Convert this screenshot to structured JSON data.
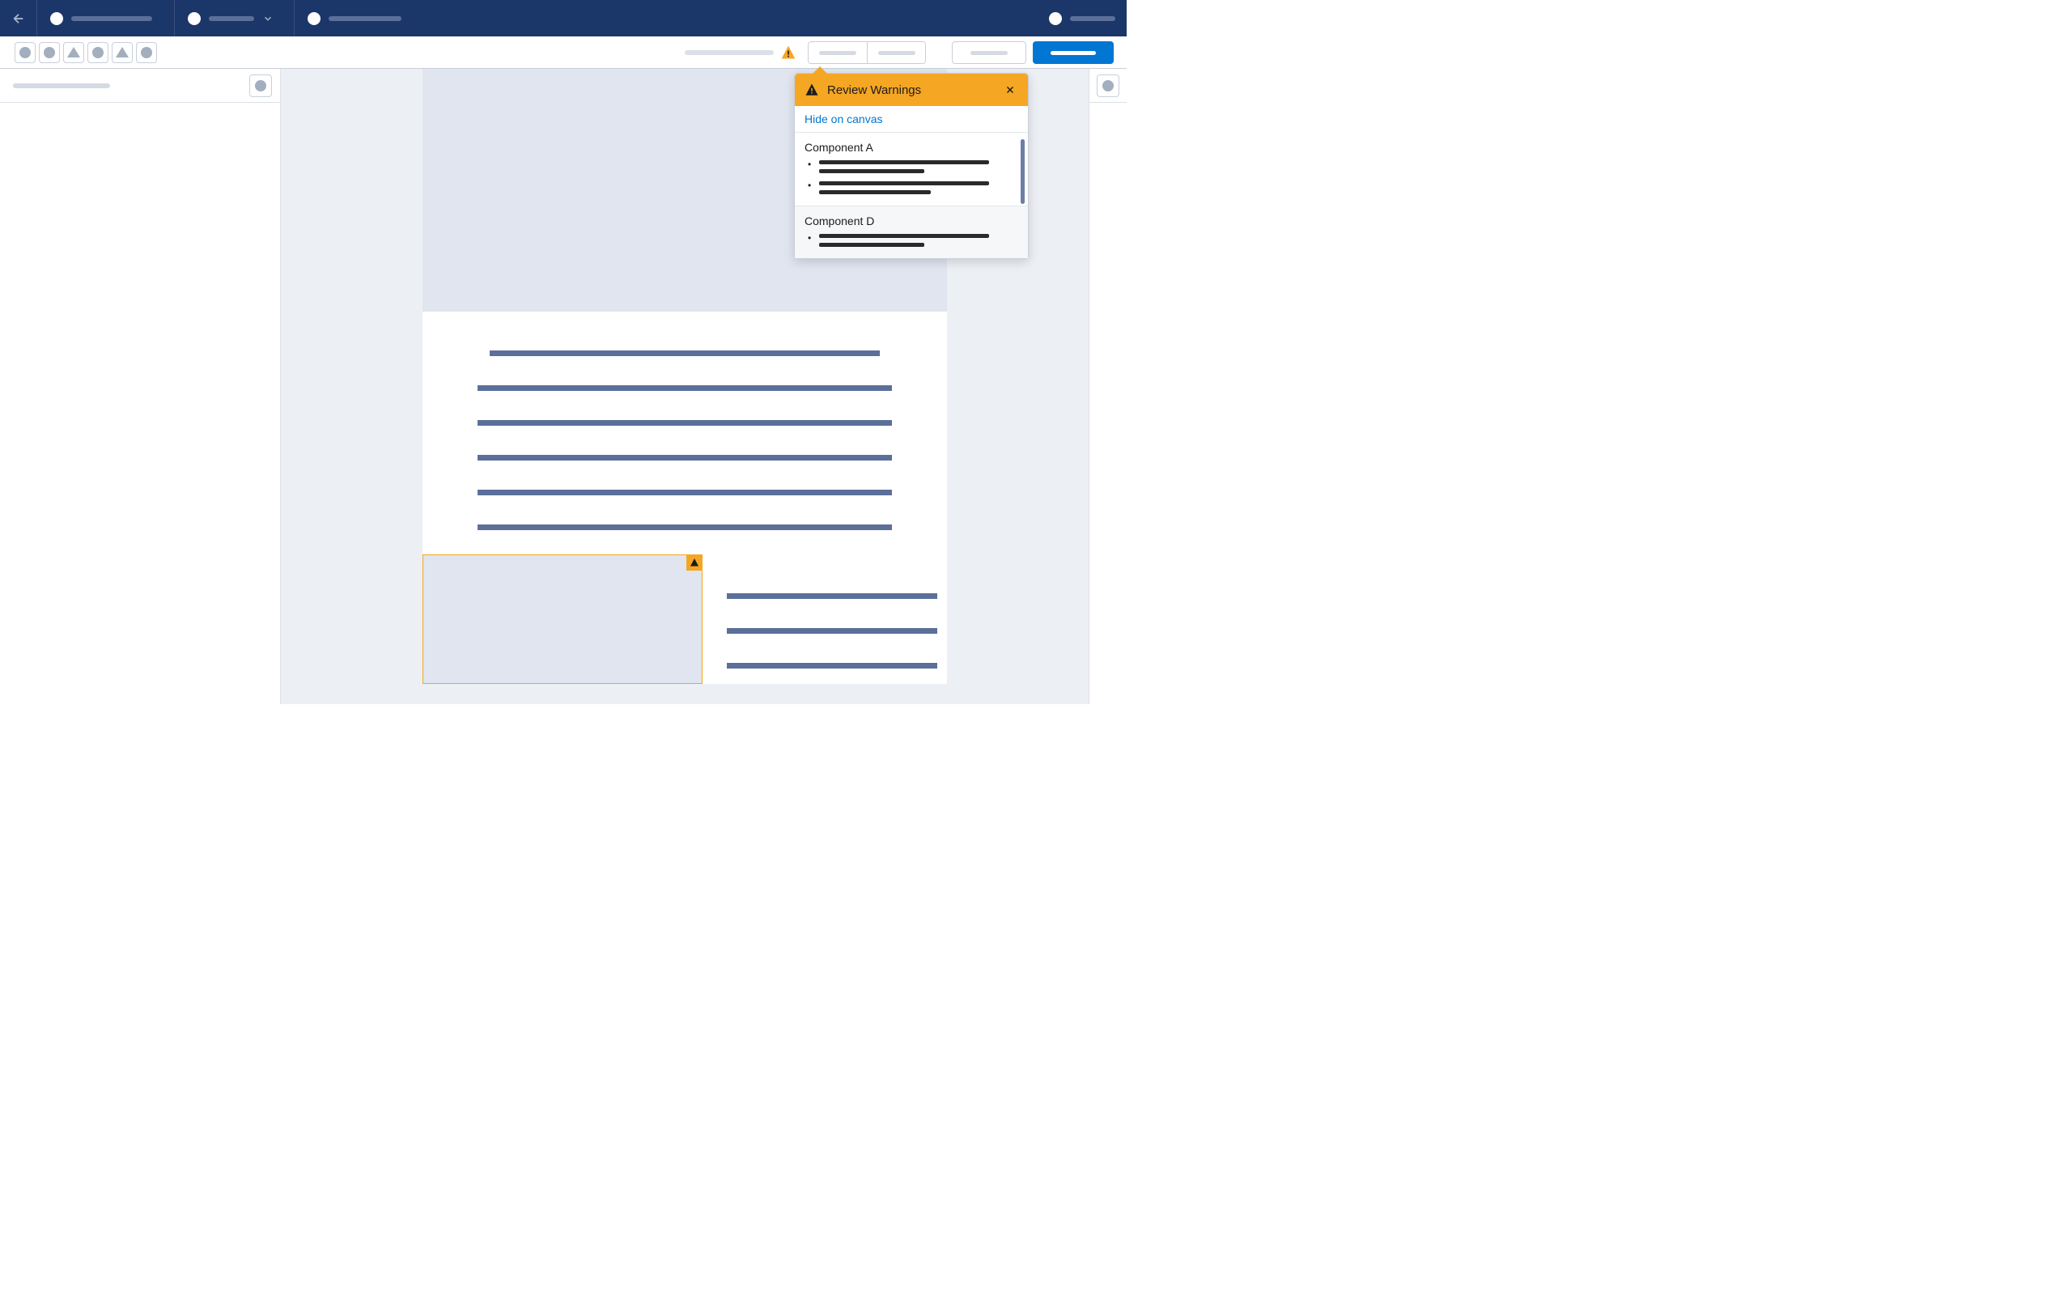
{
  "popover": {
    "title": "Review Warnings",
    "hide_link": "Hide on canvas",
    "sections": [
      {
        "title": "Component A"
      },
      {
        "title": "Component D"
      }
    ]
  },
  "icons": {
    "back": "back-arrow-icon",
    "warning": "warning-icon",
    "close": "close-icon",
    "chevron_down": "chevron-down-icon"
  }
}
